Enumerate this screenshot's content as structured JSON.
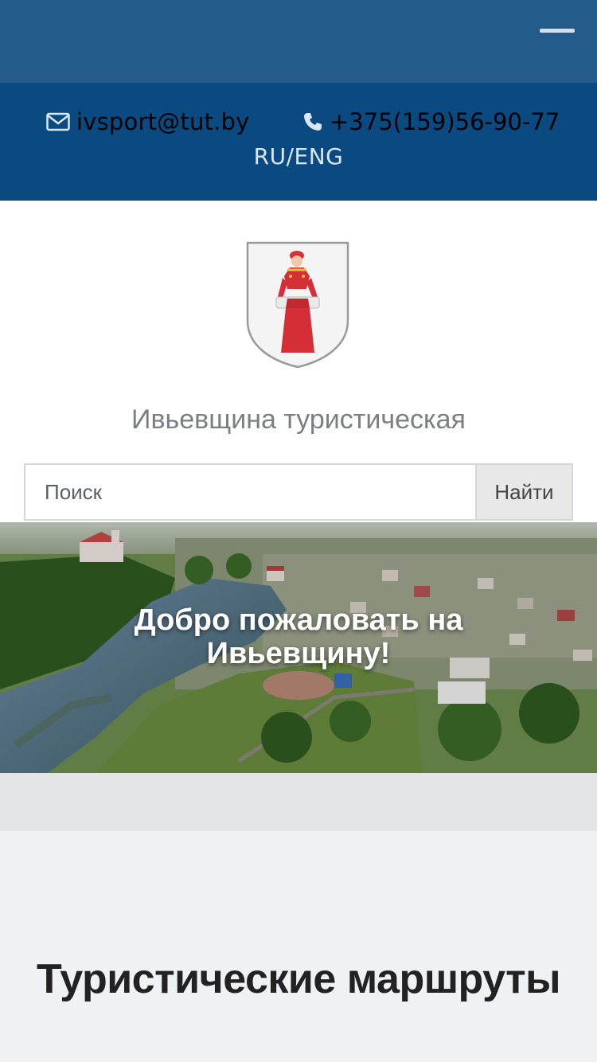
{
  "header": {
    "email": "ivsport@tut.by",
    "phone": "+375(159)56-90-77",
    "language": "RU/ENG"
  },
  "brand": {
    "site_title": "Ивьевщина туристическая"
  },
  "search": {
    "placeholder": "Поиск",
    "button_label": "Найти"
  },
  "hero": {
    "line1": "Добро пожаловать на",
    "line2": "Ивьевщину!"
  },
  "sections": {
    "routes_title": "Туристические маршруты"
  },
  "colors": {
    "topbar": "#245b8a",
    "contactbar": "#0a4a80"
  },
  "icons": [
    "menu-icon",
    "envelope-icon",
    "phone-icon",
    "coat-of-arms"
  ]
}
